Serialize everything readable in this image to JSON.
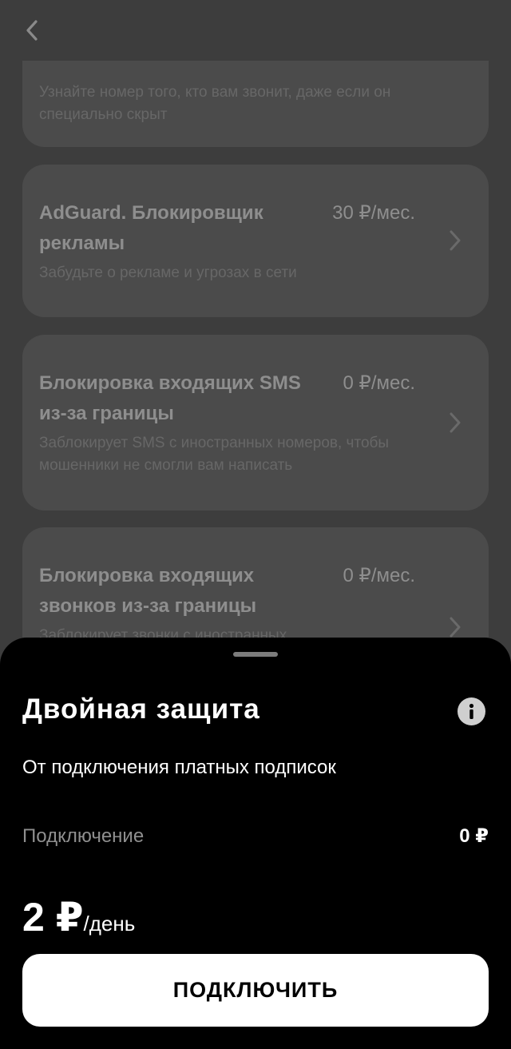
{
  "header": {
    "back_icon": "chevron-left-icon"
  },
  "services": [
    {
      "title": "",
      "price": "",
      "description": "Узнайте номер того, кто вам звонит, даже если он специально скрыт"
    },
    {
      "title": "AdGuard. Блокировщик рекламы",
      "price": "30 ₽/мес.",
      "description": "Забудьте о рекламе и угрозах в сети"
    },
    {
      "title": "Блокировка входящих SMS из-за границы",
      "price": "0 ₽/мес.",
      "description": "Заблокирует SMS с иностранных номеров, чтобы мошенники не смогли вам написать"
    },
    {
      "title": "Блокировка входящих звонков из-за границы",
      "price": "0 ₽/мес.",
      "description": "Заблокирует звонки с иностранных"
    }
  ],
  "sheet": {
    "title": "Двойная защита",
    "info_icon": "info-icon",
    "subtitle": "От подключения платных подписок",
    "fee_label": "Подключение",
    "fee_value": "0 ₽",
    "price_amount": "2 ₽",
    "price_unit": "/день",
    "connect_label": "ПОДКЛЮЧИТЬ"
  },
  "colors": {
    "background": "#3d3d3d",
    "card": "#4b4b4b",
    "sheet": "#000000",
    "button": "#ffffff"
  }
}
